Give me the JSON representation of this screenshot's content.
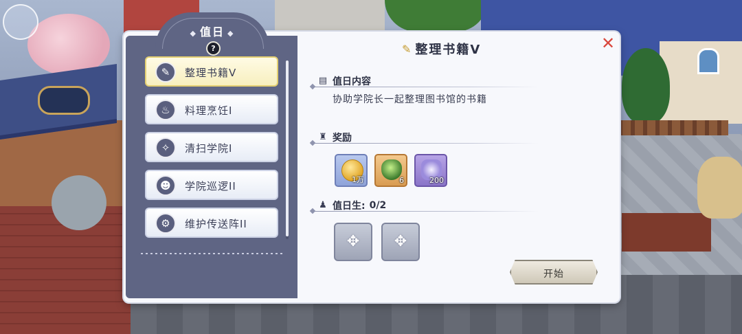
{
  "panel": {
    "title": "值日",
    "help_glyph": "?"
  },
  "duties": [
    {
      "label": "整理书籍V",
      "icon": "broom-book-icon",
      "icon_glyph": "✎",
      "selected": true
    },
    {
      "label": "料理烹饪I",
      "icon": "cooking-pot-icon",
      "icon_glyph": "♨",
      "selected": false
    },
    {
      "label": "清扫学院I",
      "icon": "broom-icon",
      "icon_glyph": "✧",
      "selected": false
    },
    {
      "label": "学院巡逻II",
      "icon": "patrol-people-icon",
      "icon_glyph": "☻",
      "selected": false
    },
    {
      "label": "维护传送阵II",
      "icon": "gear-icon",
      "icon_glyph": "⚙",
      "selected": false
    }
  ],
  "detail": {
    "title": "整理书籍V",
    "content_heading": "值日内容",
    "content_text": "协助学院长一起整理图书馆的书籍",
    "reward_heading": "奖励",
    "rewards": [
      {
        "item": "gold-coin-icon",
        "quantity": "1万"
      },
      {
        "item": "green-gem-icon",
        "quantity": "6"
      },
      {
        "item": "exp-star-icon",
        "quantity": "200"
      }
    ],
    "students_heading": "值日生:",
    "students_count": "0/2",
    "slot_glyph": "✥",
    "start_label": "开始"
  },
  "close_glyph": "✕",
  "colors": {
    "panel_bg": "#5f6584",
    "selected_item": "#f7efbf",
    "close": "#d9473d",
    "modal_bg": "#f7f8fc"
  }
}
